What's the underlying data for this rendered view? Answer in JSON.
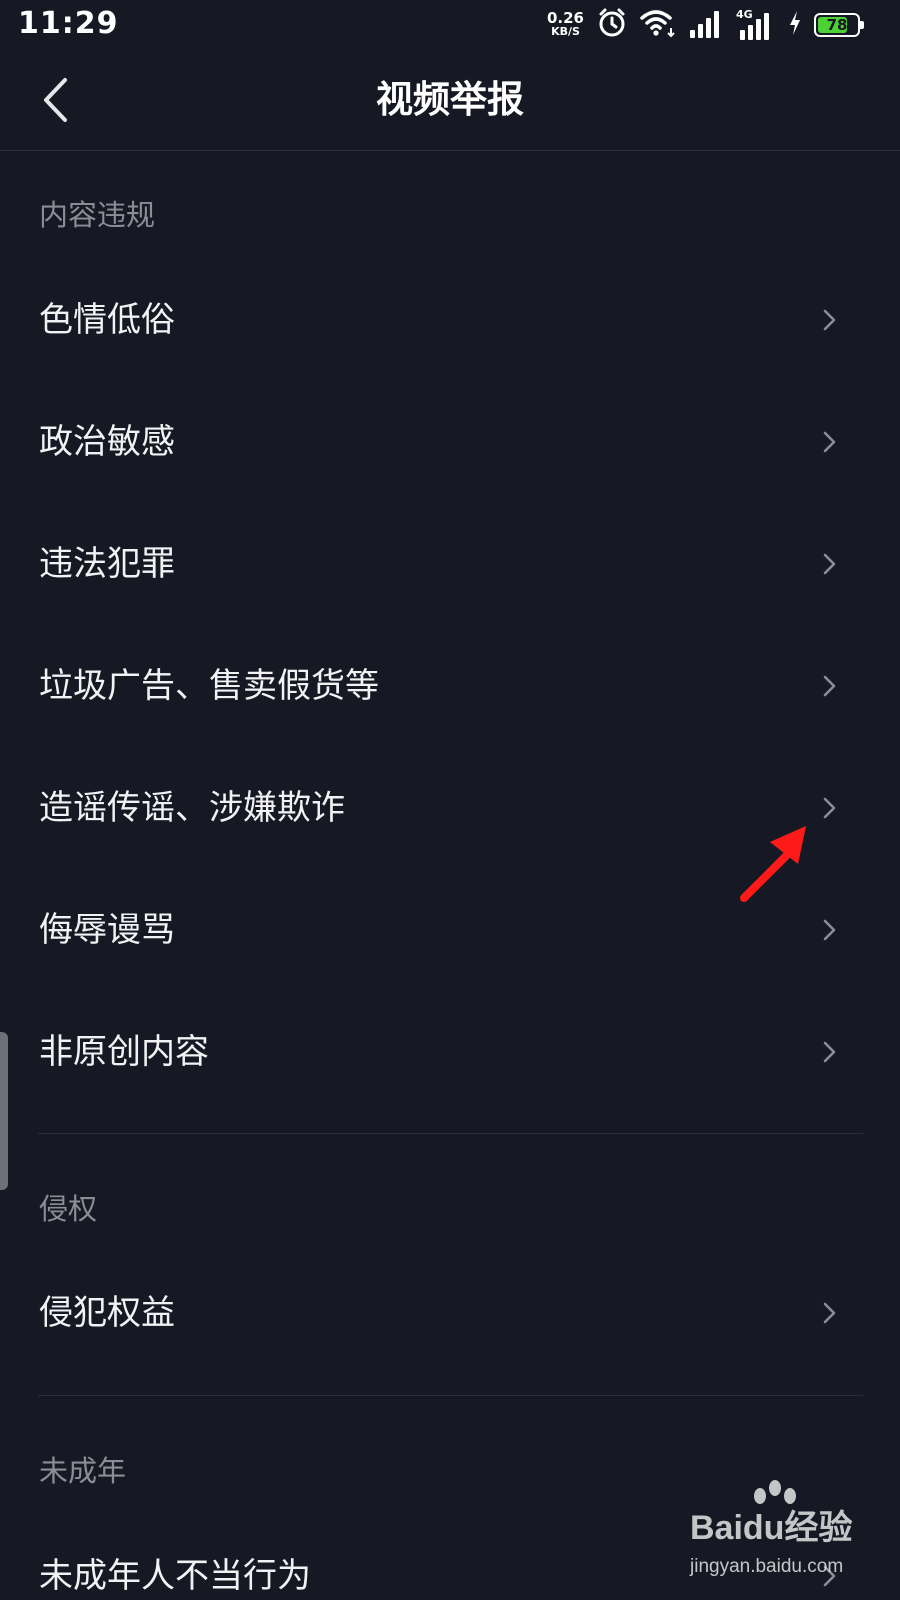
{
  "status_bar": {
    "time": "11:29",
    "net_speed_value": "0.26",
    "net_speed_unit": "KB/S",
    "network_label": "4G",
    "battery_level": 78,
    "battery_label": "78",
    "battery_color": "#4cd137"
  },
  "header": {
    "title": "视频举报",
    "back_icon": "chevron-left-icon"
  },
  "sections": [
    {
      "label": "内容违规",
      "items": [
        {
          "label": "色情低俗"
        },
        {
          "label": "政治敏感"
        },
        {
          "label": "违法犯罪"
        },
        {
          "label": "垃圾广告、售卖假货等"
        },
        {
          "label": "造谣传谣、涉嫌欺诈"
        },
        {
          "label": "侮辱谩骂"
        },
        {
          "label": "非原创内容"
        }
      ]
    },
    {
      "label": "侵权",
      "items": [
        {
          "label": "侵犯权益"
        }
      ]
    },
    {
      "label": "未成年",
      "items": [
        {
          "label": "未成年人不当行为"
        }
      ]
    }
  ],
  "annotation": {
    "arrow_color": "#ff1a1a"
  },
  "watermark": {
    "brand": "Baidu经验",
    "url": "jingyan.baidu.com"
  },
  "colors": {
    "background": "#161823",
    "text_primary": "#f2f2f4",
    "text_secondary": "#8b8d96",
    "divider": "#2b2d38"
  }
}
